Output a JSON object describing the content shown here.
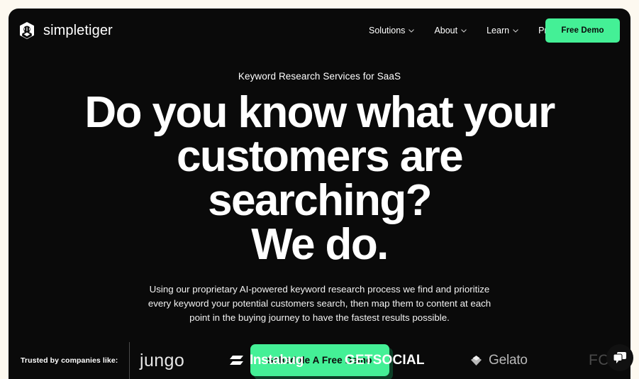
{
  "theme": {
    "page_background": "#0a0a0a",
    "outer_background": "#fdf9f0",
    "accent_green": "#44f096",
    "accent_shadow": "#0c3f27",
    "text_primary": "#ffffff"
  },
  "header": {
    "brand": {
      "name": "simpletiger",
      "mark_icon": "tiger-hexagon-icon"
    },
    "nav": [
      {
        "label": "Solutions",
        "has_dropdown": true,
        "icon": "chevron-down-icon"
      },
      {
        "label": "About",
        "has_dropdown": true,
        "icon": "chevron-down-icon"
      },
      {
        "label": "Learn",
        "has_dropdown": true,
        "icon": "chevron-down-icon"
      },
      {
        "label": "Pricing",
        "has_dropdown": false,
        "icon": ""
      }
    ],
    "cta_label": "Free Demo"
  },
  "hero": {
    "eyebrow": "Keyword Research Services for SaaS",
    "headline_line1": "Do you know what your",
    "headline_line2": "customers are searching?",
    "headline_line3": "We do.",
    "subcopy": "Using our proprietary AI-powered keyword research process we find and prioritize every keyword your potential customers search, then map them to content at each point in the buying journey to have the fastest results possible.",
    "cta_label": "Schedule A Free Demo"
  },
  "trustbar": {
    "label": "Trusted by companies like:",
    "logos": [
      {
        "name": "jungo",
        "icon": ""
      },
      {
        "name": "Instabug",
        "icon": "instabug-slash-icon"
      },
      {
        "name": "GETSOCIAL",
        "icon": ""
      },
      {
        "name": "Gelato",
        "icon": "gelato-diamond-icon"
      },
      {
        "name": "FC",
        "icon": ""
      }
    ]
  },
  "chat": {
    "icon": "chat-bubbles-icon",
    "label": "Open chat"
  }
}
